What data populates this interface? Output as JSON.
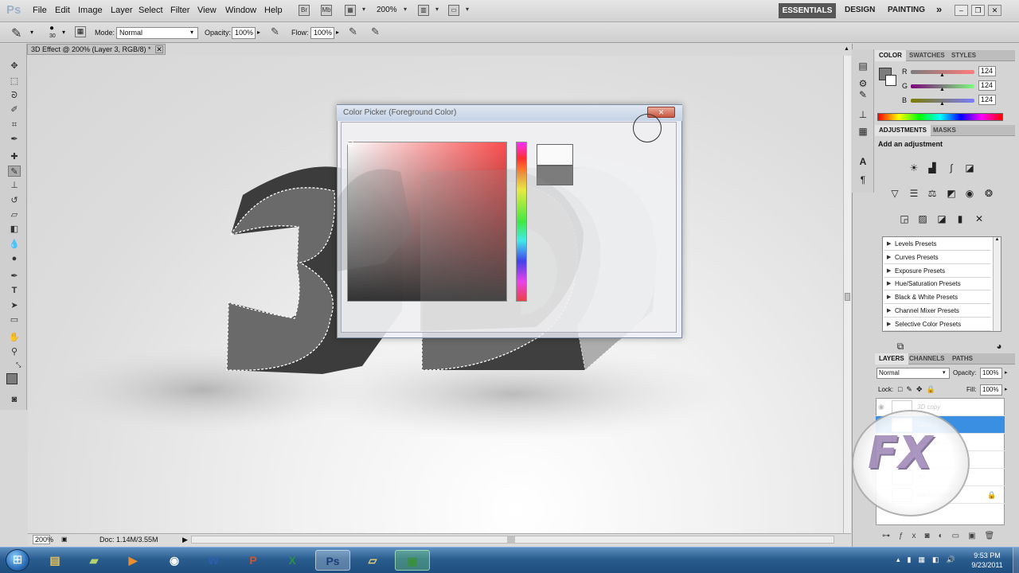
{
  "app": {
    "logo": "Ps"
  },
  "menu": [
    "File",
    "Edit",
    "Image",
    "Layer",
    "Select",
    "Filter",
    "View",
    "Window",
    "Help"
  ],
  "menubar_icons": {
    "bridge": "Br",
    "minibridge": "Mb"
  },
  "zoom_display": "200%",
  "workspaces": {
    "active": "ESSENTIALS",
    "others": [
      "DESIGN",
      "PAINTING"
    ],
    "more": "»"
  },
  "options": {
    "brush_size": "30",
    "mode_label": "Mode:",
    "mode_value": "Normal",
    "opacity_label": "Opacity:",
    "opacity_value": "100%",
    "flow_label": "Flow:",
    "flow_value": "100%"
  },
  "document": {
    "tab_title": "3D Effect @ 200% (Layer 3, RGB/8) *",
    "close": "✕",
    "zoom": "200%",
    "doc_size": "Doc: 1.14M/3.55M"
  },
  "color_panel": {
    "tabs": [
      "COLOR",
      "SWATCHES",
      "STYLES"
    ],
    "channels": [
      {
        "label": "R",
        "value": "124"
      },
      {
        "label": "G",
        "value": "124"
      },
      {
        "label": "B",
        "value": "124"
      }
    ]
  },
  "adjustments_panel": {
    "tabs": [
      "ADJUSTMENTS",
      "MASKS"
    ],
    "heading": "Add an adjustment",
    "presets": [
      "Levels Presets",
      "Curves Presets",
      "Exposure Presets",
      "Hue/Saturation Presets",
      "Black & White Presets",
      "Channel Mixer Presets",
      "Selective Color Presets"
    ]
  },
  "layers_panel": {
    "tabs": [
      "LAYERS",
      "CHANNELS",
      "PATHS"
    ],
    "blend_mode": "Normal",
    "opacity_label": "Opacity:",
    "opacity_value": "100%",
    "lock_label": "Lock:",
    "fill_label": "Fill:",
    "fill_value": "100%",
    "layers": [
      {
        "name": "3D copy",
        "selected": false
      },
      {
        "name": "Layer 3",
        "selected": true
      },
      {
        "name": "3D copy 2",
        "selected": false
      },
      {
        "name": "",
        "selected": false
      },
      {
        "name": "3D",
        "selected": false
      },
      {
        "name": "Background",
        "selected": false
      }
    ]
  },
  "color_picker": {
    "title": "Color Picker (Foreground Color)",
    "close": "✕"
  },
  "canvas_art": {
    "text": "3D"
  },
  "watermark": {
    "text": "FX"
  },
  "taskbar": {
    "apps": [
      {
        "name": "Windows Explorer",
        "glyph": "▤",
        "color": "#e8c25a"
      },
      {
        "name": "Notes",
        "glyph": "▰",
        "color": "#b5d46a"
      },
      {
        "name": "Media",
        "glyph": "▶",
        "color": "#ee8d2e"
      },
      {
        "name": "Chrome",
        "glyph": "◉",
        "color": "#ffffff"
      },
      {
        "name": "Word",
        "glyph": "W",
        "color": "#2d5fae"
      },
      {
        "name": "PowerPoint",
        "glyph": "P",
        "color": "#d2552c"
      },
      {
        "name": "Excel",
        "glyph": "X",
        "color": "#2f8f45"
      },
      {
        "name": "Photoshop",
        "glyph": "Ps",
        "color": "#1e3c78"
      },
      {
        "name": "Folder",
        "glyph": "▱",
        "color": "#e9d173"
      },
      {
        "name": "Camtasia",
        "glyph": "▣",
        "color": "#3a8f3a"
      }
    ],
    "time": "9:53 PM",
    "date": "9/23/2011"
  }
}
